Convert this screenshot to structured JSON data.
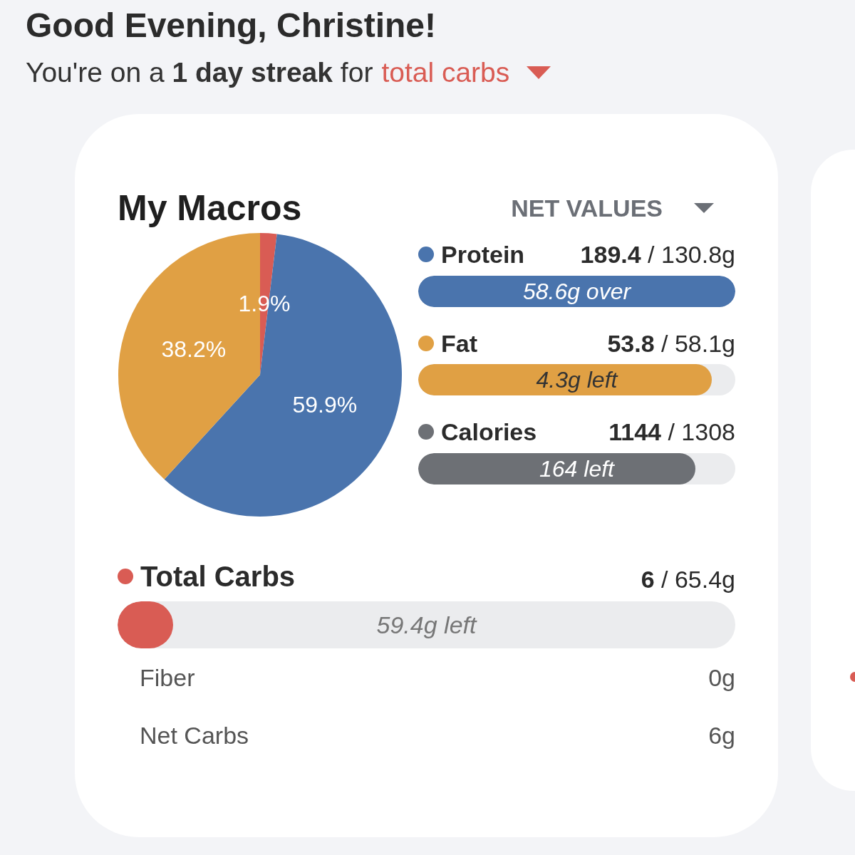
{
  "greeting": "Good Evening, Christine!",
  "streak": {
    "text": "You're on a **1 day streak** for",
    "link": "total carbs"
  },
  "card": {
    "title": "My Macros",
    "dropdown": "NET VALUES",
    "chart_data": {
      "type": "pie",
      "values": [
        1.9,
        59.9,
        38.2
      ],
      "colors": [
        "#d95c54",
        "#4a74ad",
        "#e0a044"
      ],
      "value_labels": [
        "1.9%",
        "59.9%",
        "38.2%"
      ]
    },
    "macros": [
      {
        "name": "Protein",
        "color": "#4a74ad",
        "amount": "**189.4** / 130.8g",
        "level": 1,
        "note": "58.6g over"
      },
      {
        "name": "Fat",
        "color": "#e0a044",
        "amount": "**53.8** / 58.1g",
        "level": 0.926,
        "note": "4.3g left"
      },
      {
        "name": "Calories",
        "color": "#6d7075",
        "amount": "**1144** / 1308",
        "level": 0.875,
        "note": "164 left"
      }
    ],
    "carbs": {
      "name": "Total Carbs",
      "color": "#d95c54",
      "amount": "**6** / 65.4g",
      "level": 0.09,
      "note": "59.4g left"
    },
    "details": [
      {
        "label": "Fiber",
        "value": "0g"
      },
      {
        "label": "Net Carbs",
        "value": "6g"
      }
    ]
  }
}
